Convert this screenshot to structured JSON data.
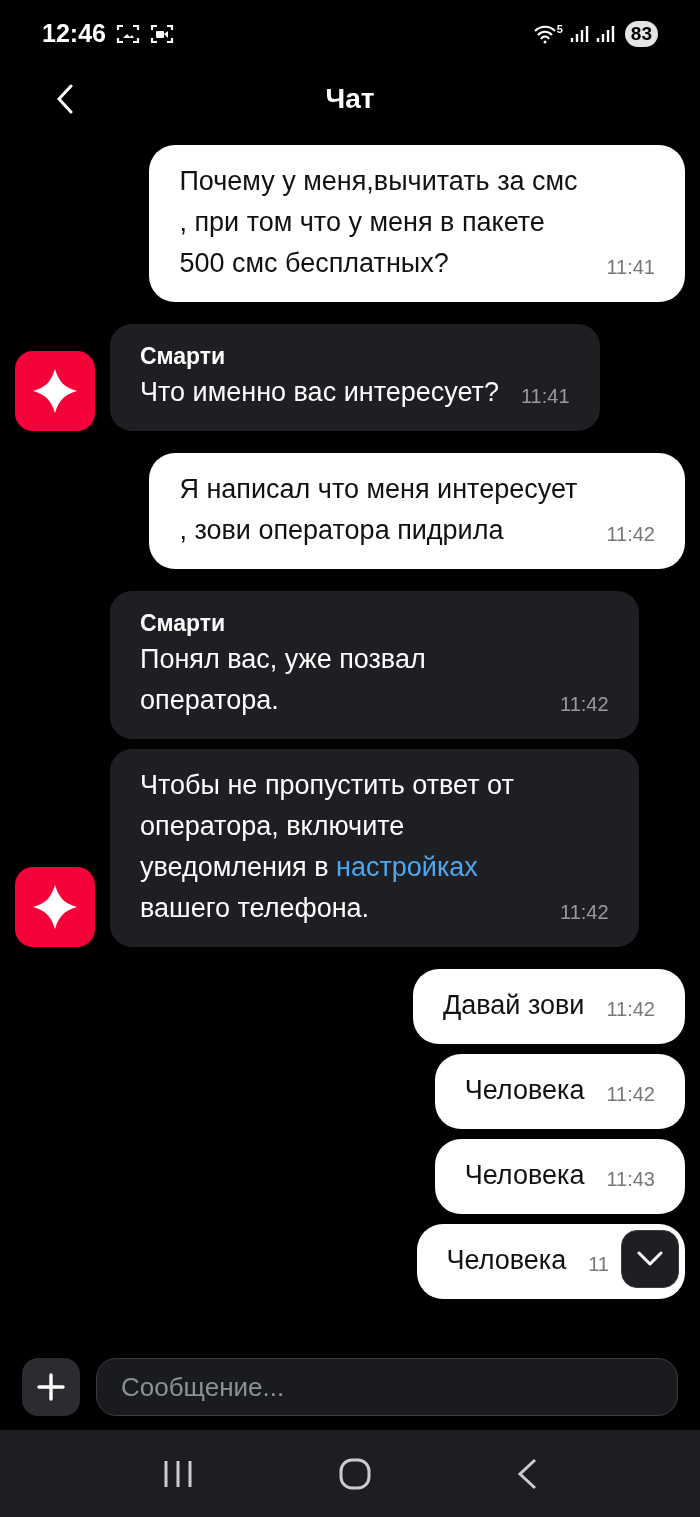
{
  "status_bar": {
    "time": "12:46",
    "battery": "83",
    "network": "5"
  },
  "header": {
    "title": "Чат"
  },
  "messages": [
    {
      "kind": "outgoing",
      "parts": [
        {
          "kind": "text",
          "text": "Почему у меня,вычитать за смс , при том что у меня в пакете 500 смс бесплатных?"
        }
      ],
      "time": "11:41"
    },
    {
      "kind": "incoming",
      "sender": "Смарти",
      "show_avatar": true,
      "parts": [
        {
          "kind": "text",
          "text": "Что именно вас интересует?"
        }
      ],
      "time": "11:41"
    },
    {
      "kind": "outgoing",
      "parts": [
        {
          "kind": "text",
          "text": "Я написал что меня интересует , зови оператора пидрила"
        }
      ],
      "time": "11:42"
    },
    {
      "kind": "incoming",
      "sender": "Смарти",
      "show_avatar": false,
      "parts": [
        {
          "kind": "text",
          "text": "Понял вас, уже позвал оператора."
        }
      ],
      "time": "11:42"
    },
    {
      "kind": "incoming",
      "show_avatar": true,
      "parts": [
        {
          "kind": "text",
          "text": "Чтобы не пропустить ответ от оператора, включите уведомления в "
        },
        {
          "kind": "link",
          "text": "настройках"
        },
        {
          "kind": "text",
          "text": " вашего телефона."
        }
      ],
      "time": "11:42"
    },
    {
      "kind": "outgoing",
      "parts": [
        {
          "kind": "text",
          "text": "Давай зови"
        }
      ],
      "time": "11:42"
    },
    {
      "kind": "outgoing",
      "parts": [
        {
          "kind": "text",
          "text": "Человека"
        }
      ],
      "time": "11:42"
    },
    {
      "kind": "outgoing",
      "parts": [
        {
          "kind": "text",
          "text": "Человека"
        }
      ],
      "time": "11:43"
    },
    {
      "kind": "outgoing",
      "parts": [
        {
          "kind": "text",
          "text": "Человека"
        }
      ],
      "time": "11"
    }
  ],
  "composer": {
    "placeholder": "Сообщение..."
  }
}
